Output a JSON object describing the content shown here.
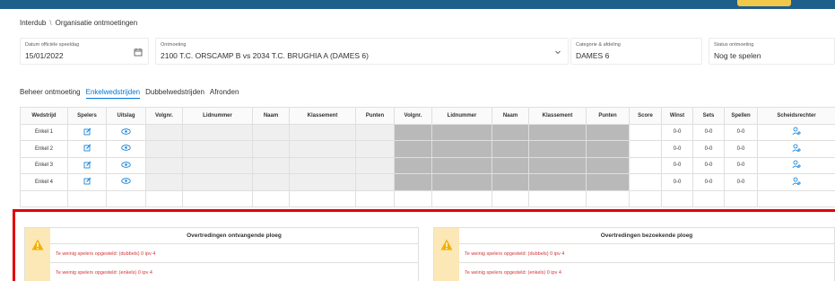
{
  "breadcrumb": {
    "root": "Interdub",
    "separator": "\\",
    "current": "Organisatie ontmoetingen"
  },
  "fields": {
    "date": {
      "label": "Datum officiële speeldag",
      "value": "15/01/2022"
    },
    "match": {
      "label": "Ontmoeting",
      "value": "2100 T.C. ORSCAMP B vs 2034 T.C. BRUGHIA A (DAMES 6)"
    },
    "category": {
      "label": "Categorie & afdeling",
      "value": "DAMES 6"
    },
    "status": {
      "label": "Status ontmoeting",
      "value": "Nog te spelen"
    }
  },
  "tabs": [
    {
      "label": "Beheer ontmoeting",
      "active": false
    },
    {
      "label": "Enkelwedstrijden",
      "active": true
    },
    {
      "label": "Dubbelwedstrijden",
      "active": false
    },
    {
      "label": "Afronden",
      "active": false
    }
  ],
  "table": {
    "headers": [
      "Wedstrijd",
      "Spelers",
      "Uitslag",
      "Volgnr.",
      "Lidnummer",
      "Naam",
      "Klassement",
      "Punten",
      "Volgnr.",
      "Lidnummer",
      "Naam",
      "Klassement",
      "Punten",
      "Score",
      "Winst",
      "Sets",
      "Spellen",
      "Scheidsrechter"
    ],
    "rows": [
      {
        "wedstrijd": "Enkel 1",
        "winst": "0-0",
        "sets": "0-0",
        "spellen": "0-0"
      },
      {
        "wedstrijd": "Enkel 2",
        "winst": "0-0",
        "sets": "0-0",
        "spellen": "0-0"
      },
      {
        "wedstrijd": "Enkel 3",
        "winst": "0-0",
        "sets": "0-0",
        "spellen": "0-0"
      },
      {
        "wedstrijd": "Enkel 4",
        "winst": "0-0",
        "sets": "0-0",
        "spellen": "0-0"
      }
    ]
  },
  "warnings": {
    "home": {
      "title": "Overtredingen ontvangende ploeg",
      "items": [
        "Te weinig spelers opgesteld: (dubbels) 0 ipv 4",
        "Te weinig spelers opgesteld: (enkels) 0 ipv 4"
      ]
    },
    "away": {
      "title": "Overtredingen bezoekende ploeg",
      "items": [
        "Te weinig spelers opgesteld: (dubbels) 0 ipv 4",
        "Te weinig spelers opgesteld: (enkels) 0 ipv 4"
      ]
    }
  },
  "colors": {
    "accent": "#0078d4",
    "error": "#d13438",
    "highlight": "#e00000",
    "warning_bg": "#fce8b6",
    "topbar": "#1f5f8b"
  },
  "icons": {
    "calendar": "calendar-icon",
    "dropdown": "chevron-down-icon",
    "edit": "edit-icon",
    "result": "view-icon",
    "referee": "add-person-icon",
    "warning": "warning-icon"
  }
}
